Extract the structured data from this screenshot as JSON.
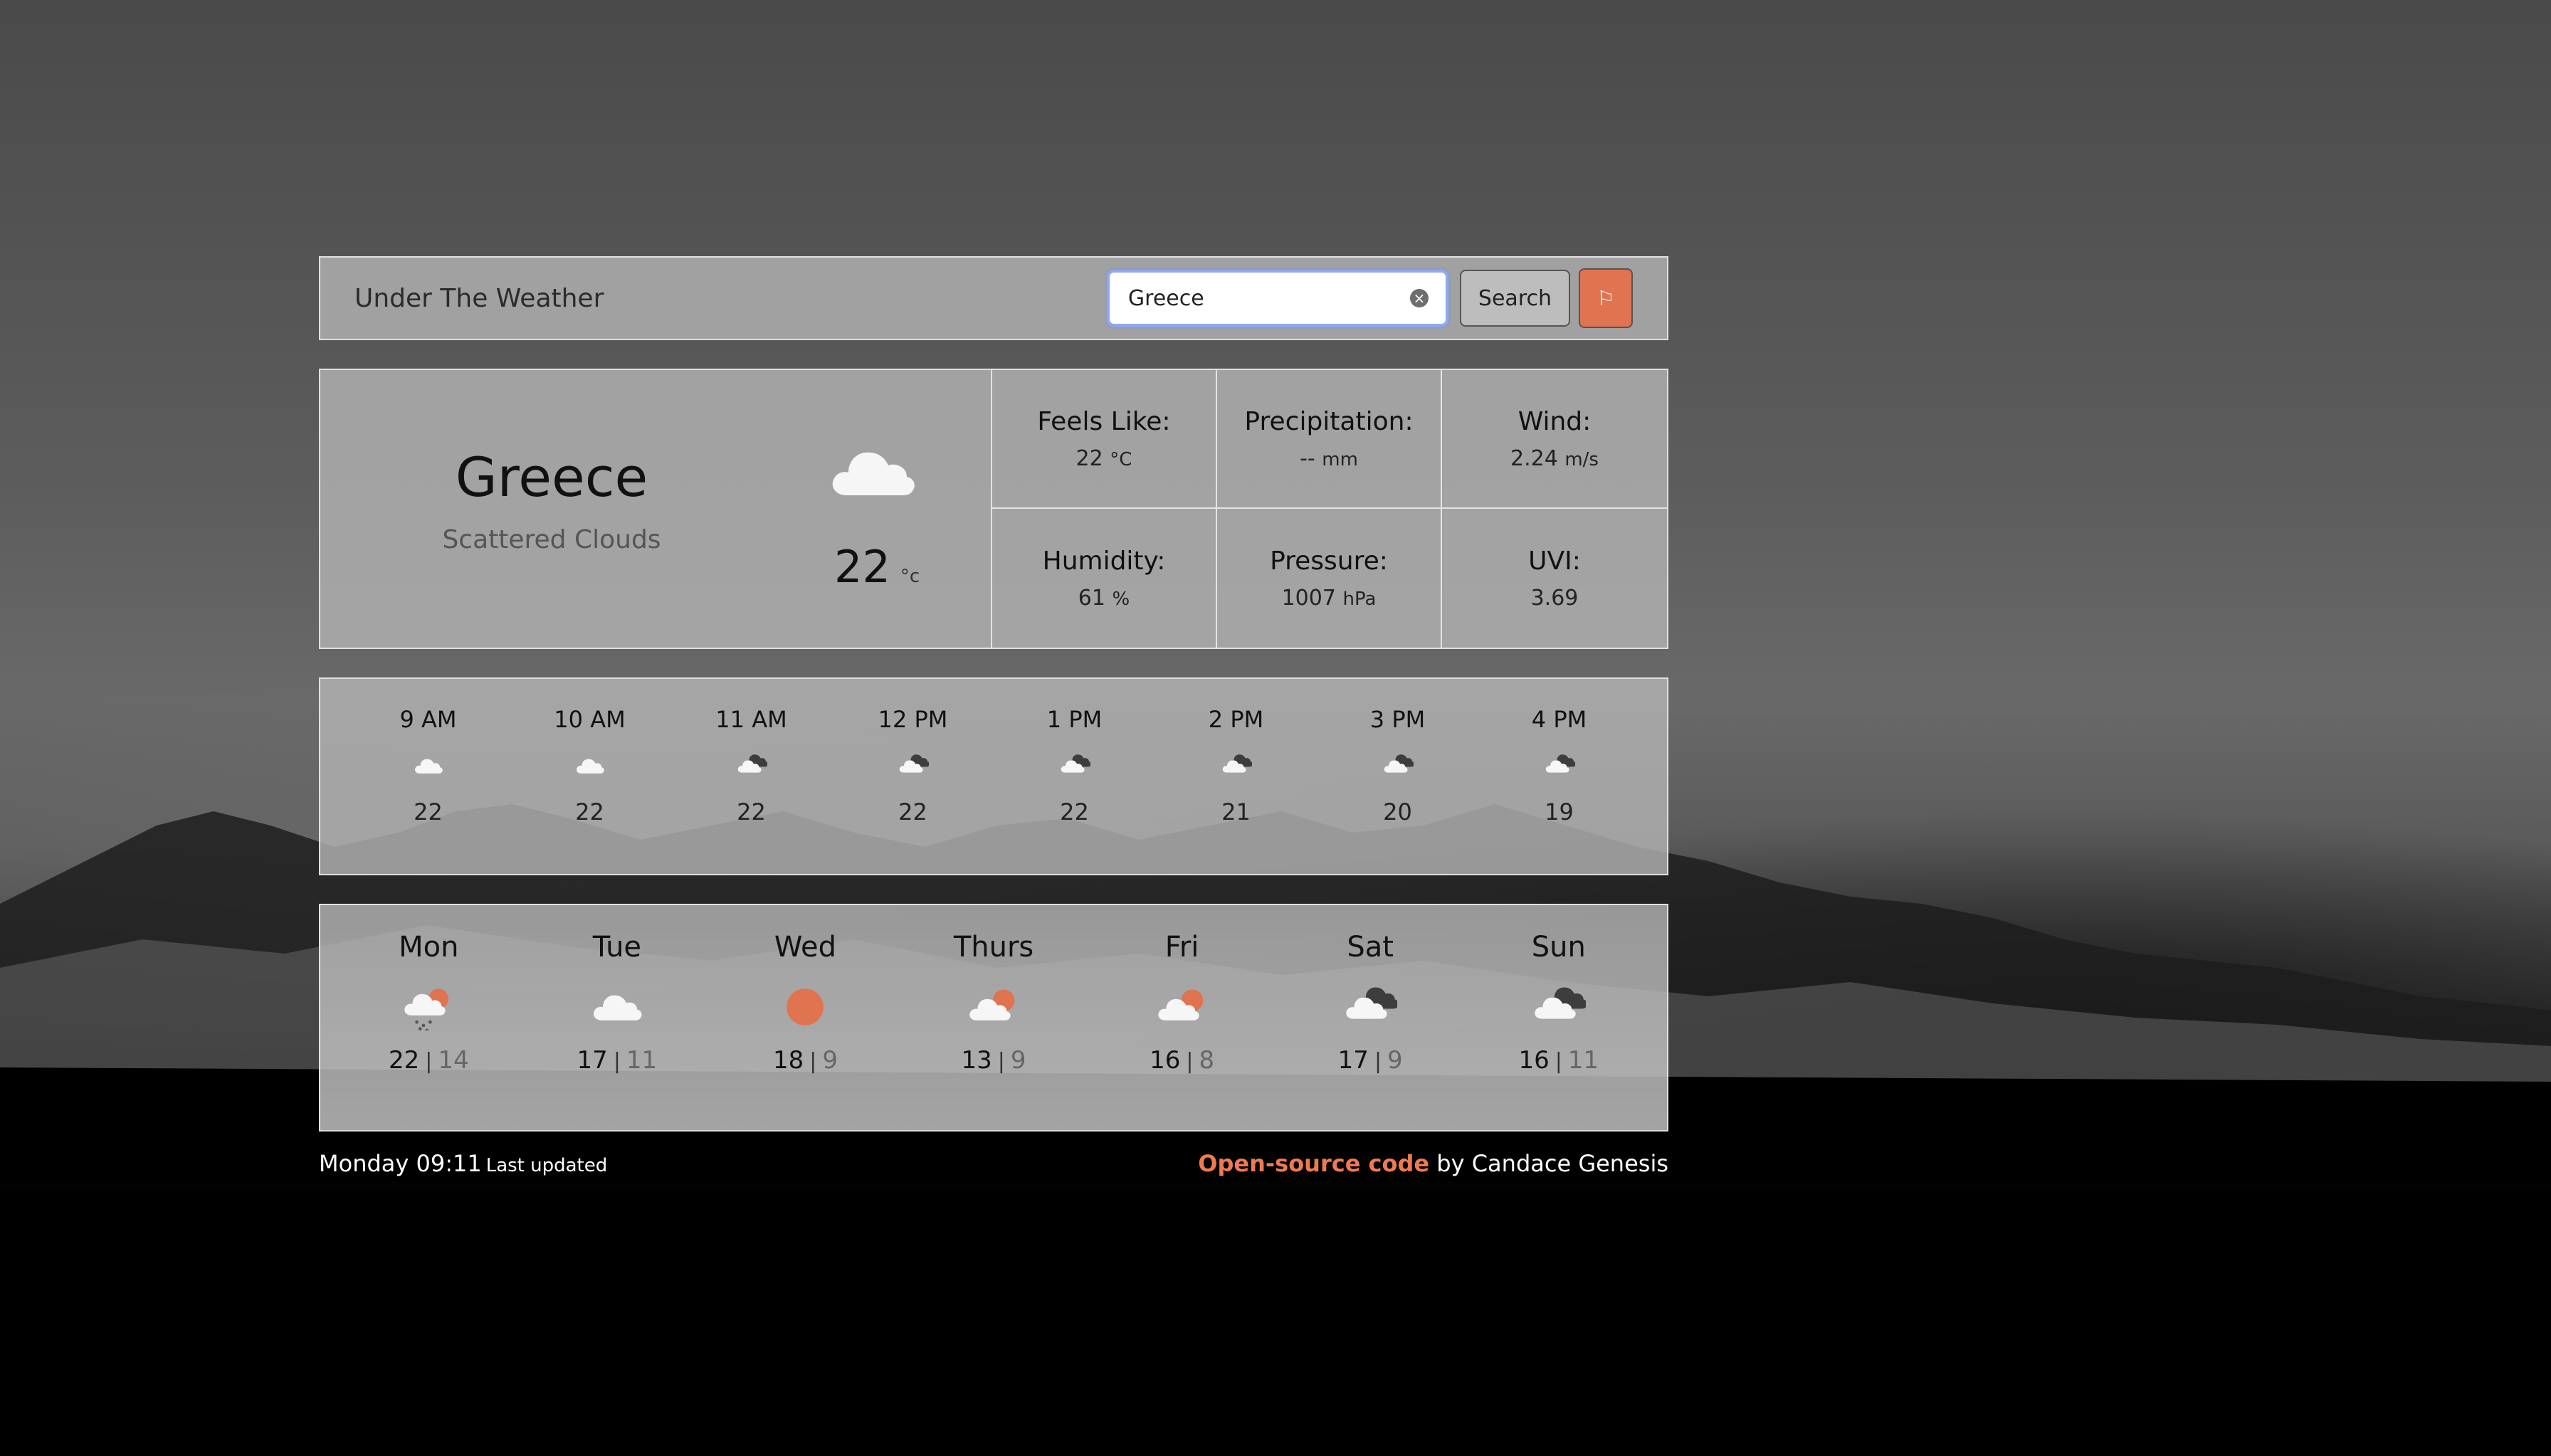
{
  "nav": {
    "brand": "Under The Weather",
    "search_value": "Greece",
    "search_button": "Search"
  },
  "current": {
    "city": "Greece",
    "description": "Scattered Clouds",
    "temperature": "22",
    "temp_unit": "°c",
    "icon": "cloud-icon"
  },
  "details": {
    "feels_like": {
      "label": "Feels Like:",
      "value": "22",
      "unit": "°C"
    },
    "precipitation": {
      "label": "Precipitation:",
      "value": "--",
      "unit": "mm"
    },
    "wind": {
      "label": "Wind:",
      "value": "2.24",
      "unit": "m/s"
    },
    "humidity": {
      "label": "Humidity:",
      "value": "61",
      "unit": "%"
    },
    "pressure": {
      "label": "Pressure:",
      "value": "1007",
      "unit": "hPa"
    },
    "uvi": {
      "label": "UVI:",
      "value": "3.69"
    }
  },
  "hourly": [
    {
      "time": "9 AM",
      "temp": "22",
      "icon": "cloud-icon"
    },
    {
      "time": "10 AM",
      "temp": "22",
      "icon": "cloud-icon"
    },
    {
      "time": "11 AM",
      "temp": "22",
      "icon": "broken-clouds-icon"
    },
    {
      "time": "12 PM",
      "temp": "22",
      "icon": "broken-clouds-icon"
    },
    {
      "time": "1 PM",
      "temp": "22",
      "icon": "broken-clouds-icon"
    },
    {
      "time": "2 PM",
      "temp": "21",
      "icon": "broken-clouds-icon"
    },
    {
      "time": "3 PM",
      "temp": "20",
      "icon": "broken-clouds-icon"
    },
    {
      "time": "4 PM",
      "temp": "19",
      "icon": "broken-clouds-icon"
    }
  ],
  "daily": [
    {
      "day": "Mon",
      "high": "22",
      "low": "14",
      "icon": "sun-rain-icon"
    },
    {
      "day": "Tue",
      "high": "17",
      "low": "11",
      "icon": "cloud-icon"
    },
    {
      "day": "Wed",
      "high": "18",
      "low": "9",
      "icon": "sun-icon"
    },
    {
      "day": "Thurs",
      "high": "13",
      "low": "9",
      "icon": "partly-cloudy-icon"
    },
    {
      "day": "Fri",
      "high": "16",
      "low": "8",
      "icon": "partly-cloudy-icon"
    },
    {
      "day": "Sat",
      "high": "17",
      "low": "9",
      "icon": "broken-clouds-icon"
    },
    {
      "day": "Sun",
      "high": "16",
      "low": "11",
      "icon": "broken-clouds-icon"
    }
  ],
  "footer": {
    "updated_time": "Monday 09:11",
    "updated_label": "Last updated",
    "link_text": "Open-source code",
    "credit_text": "by Candace Genesis"
  },
  "colors": {
    "accent": "#e07350",
    "link": "#f07a50"
  }
}
